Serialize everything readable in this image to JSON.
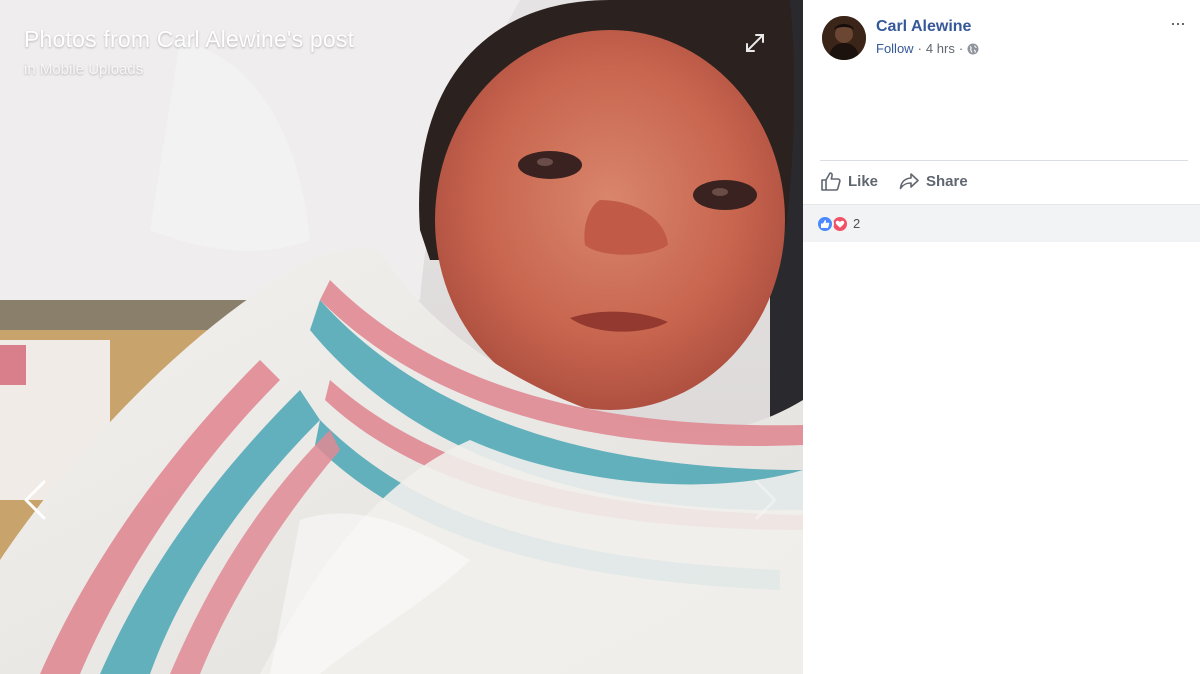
{
  "viewer": {
    "title": "Photos from Carl Alewine's post",
    "album": "in Mobile Uploads"
  },
  "post": {
    "author": "Carl Alewine",
    "follow_label": "Follow",
    "separator": "·",
    "time": "4 hrs",
    "privacy_icon": "globe-icon",
    "more_label": "···"
  },
  "actions": {
    "like_label": "Like",
    "share_label": "Share"
  },
  "reactions": {
    "types": [
      "like",
      "love"
    ],
    "count": "2"
  },
  "colors": {
    "link": "#365899",
    "like_blue": "#4a89ff",
    "love_red": "#f25268",
    "muted_text": "#616770",
    "bar_bg": "#f2f3f5"
  }
}
